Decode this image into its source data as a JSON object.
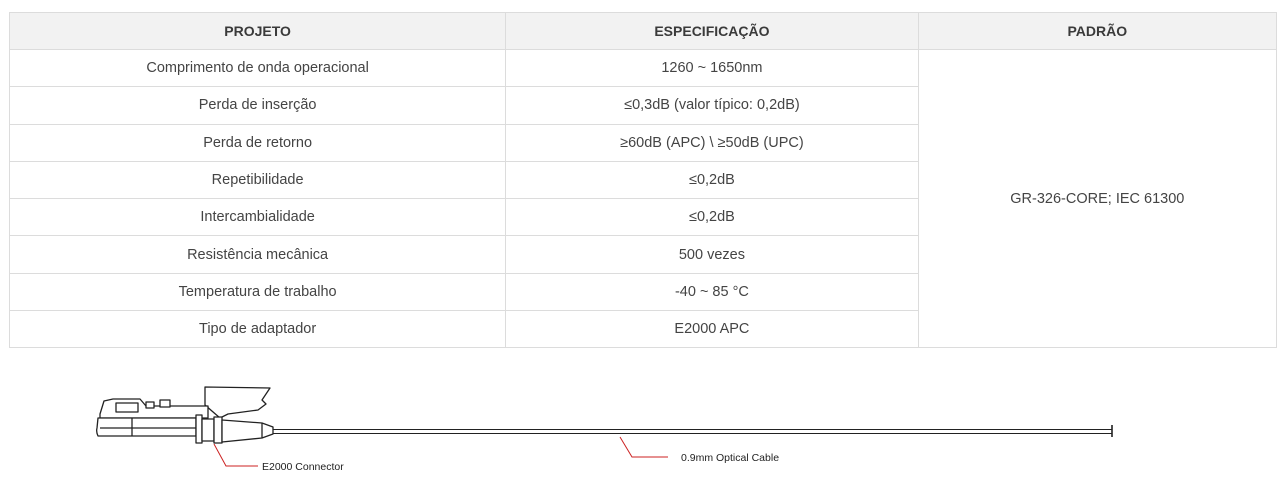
{
  "table": {
    "headers": [
      "PROJETO",
      "ESPECIFICAÇÃO",
      "PADRÃO"
    ],
    "rows": [
      {
        "item": "Comprimento de onda operacional",
        "spec": "1260 ~ 1650nm"
      },
      {
        "item": "Perda de inserção",
        "spec": "≤0,3dB (valor típico: 0,2dB)"
      },
      {
        "item": "Perda de retorno",
        "spec": "≥60dB (APC) \\ ≥50dB (UPC)"
      },
      {
        "item": "Repetibilidade",
        "spec": "≤0,2dB"
      },
      {
        "item": "Intercambialidade",
        "spec": "≤0,2dB"
      },
      {
        "item": "Resistência mecânica",
        "spec": "500 vezes"
      },
      {
        "item": "Temperatura de trabalho",
        "spec": "-40 ~ 85 °C"
      },
      {
        "item": "Tipo de adaptador",
        "spec": "E2000 APC"
      }
    ],
    "standard": "GR-326-CORE; IEC 61300"
  },
  "diagram": {
    "connector_label": "E2000 Connector",
    "cable_label": "0.9mm Optical Cable",
    "leader_color": "#cc2222"
  }
}
